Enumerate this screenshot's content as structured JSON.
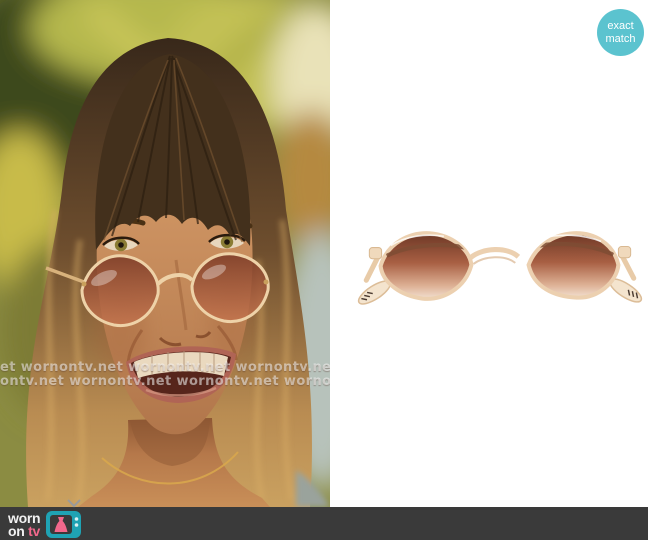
{
  "badge": {
    "line1": "exact",
    "line2": "match",
    "bg_color": "#5bc3cf",
    "text_color": "#ffffff"
  },
  "watermark": {
    "text": "wornontv.net",
    "row1": "et  wornontv.net  wornontv.net  wornontv.net  wornontv.net",
    "row2": "ontv.net  wornontv.net  wornontv.net  wornontv.net  wornon"
  },
  "logo": {
    "worn": "worn",
    "on": "on",
    "tv": "tv",
    "bar_color": "#3a3a3a",
    "text_color": "#f2f2f2",
    "tv_text_color": "#f2688c",
    "tv_icon_color": "#1fa3b4",
    "dress_color": "#f2688c"
  },
  "images": {
    "screenshot_alt": "Woman with long brown hair and bangs wearing small round clear-frame sunglasses with brown lenses, smiling, blurred palm trees behind",
    "product_alt": "Clear champagne rounded-diamond sunglasses with brown gradient lenses"
  }
}
